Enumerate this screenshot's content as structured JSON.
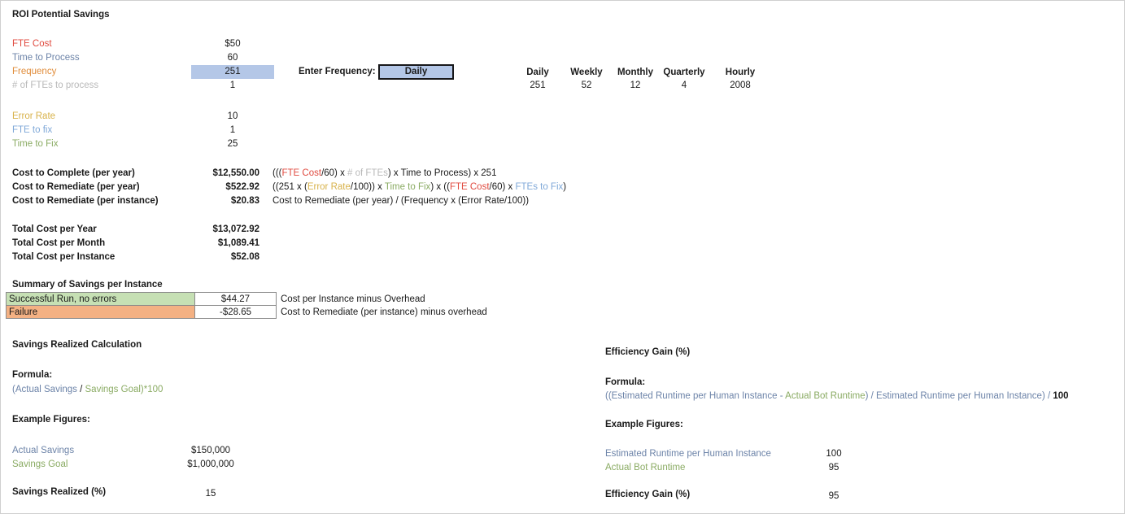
{
  "title": "ROI Potential Savings",
  "inputs": {
    "rows": [
      {
        "label": "FTE Cost",
        "value": "$50",
        "color": "c-red"
      },
      {
        "label": "Time to Process",
        "value": "60",
        "color": "c-blue"
      },
      {
        "label": "Frequency",
        "value": "251",
        "color": "c-orng",
        "highlight": true
      },
      {
        "label": "# of FTEs to process",
        "value": "1",
        "color": "c-gray"
      }
    ],
    "rows2": [
      {
        "label": "Error Rate",
        "value": "10",
        "color": "c-gold"
      },
      {
        "label": "FTE to fix",
        "value": "1",
        "color": "c-blue2"
      },
      {
        "label": "Time to Fix",
        "value": "25",
        "color": "c-green"
      }
    ]
  },
  "frequency_control": {
    "label": "Enter Frequency:",
    "selected": "Daily",
    "options": [
      "Daily",
      "Weekly",
      "Monthly",
      "Quarterly",
      "Hourly"
    ]
  },
  "frequency_table": {
    "headers": [
      "Daily",
      "Weekly",
      "Monthly",
      "Quarterly",
      "Hourly"
    ],
    "values": [
      "251",
      "52",
      "12",
      "4",
      "2008"
    ]
  },
  "costs": {
    "rows": [
      {
        "label": "Cost to Complete (per year)",
        "value": "$12,550.00"
      },
      {
        "label": "Cost to Remediate (per year)",
        "value": "$522.92"
      },
      {
        "label": "Cost to Remediate (per instance)",
        "value": "$20.83"
      }
    ],
    "formula1": {
      "p1": "(((",
      "t1": "FTE Cost",
      "p2": "/60) x ",
      "t2": "# of FTEs",
      "p3": ") x ",
      "t3": "Time to Process",
      "p4": ") x 251"
    },
    "formula2": {
      "p1": "((251 x (",
      "t1": "Error Rate",
      "p2": "/100)) x ",
      "t2": "Time to Fix",
      "p3": ") x ((",
      "t3": "FTE Cost",
      "p4": "/60) x ",
      "t4": "FTEs to Fix",
      "p5": ")"
    },
    "formula3": "Cost to Remediate (per year) / (Frequency x (Error Rate/100))"
  },
  "totals": {
    "rows": [
      {
        "label": "Total Cost per Year",
        "value": "$13,072.92"
      },
      {
        "label": "Total Cost per Month",
        "value": "$1,089.41"
      },
      {
        "label": "Total Cost per Instance",
        "value": "$52.08"
      }
    ]
  },
  "summary": {
    "title": "Summary of Savings per Instance",
    "rows": [
      {
        "label": "Successful Run, no errors",
        "value": "$44.27",
        "note": "Cost per Instance minus Overhead"
      },
      {
        "label": "Failure",
        "value": "-$28.65",
        "note": "Cost to Remediate (per instance) minus overhead"
      }
    ]
  },
  "savings_realized": {
    "title": "Savings Realized Calculation",
    "formula_label": "Formula:",
    "formula": {
      "p1": "(",
      "t1": "Actual Savings",
      "p2": " / ",
      "t2": "Savings Goal",
      "p3": ")*100"
    },
    "example_label": "Example Figures:",
    "rows": [
      {
        "label": "Actual Savings",
        "value": "$150,000",
        "color": "c-blue"
      },
      {
        "label": "Savings Goal",
        "value": "$1,000,000",
        "color": "c-green"
      }
    ],
    "result": {
      "label": "Savings Realized (%)",
      "value": "15"
    }
  },
  "efficiency_gain": {
    "title": "Efficiency Gain (%)",
    "formula_label": "Formula:",
    "formula": {
      "p1": "((",
      "t1": "Estimated Runtime per Human Instance",
      "p2": " - ",
      "t2": "Actual Bot Runtime",
      "p3": ") / ",
      "t3": "Estimated Runtime per Human Instance",
      "p4": ") / ",
      "p5": "100"
    },
    "example_label": "Example Figures:",
    "rows": [
      {
        "label": "Estimated Runtime per Human Instance",
        "value": "100",
        "color": "c-blue"
      },
      {
        "label": "Actual Bot Runtime",
        "value": "95",
        "color": "c-green"
      }
    ],
    "result": {
      "label": "Efficiency Gain (%)",
      "value": "95"
    }
  }
}
